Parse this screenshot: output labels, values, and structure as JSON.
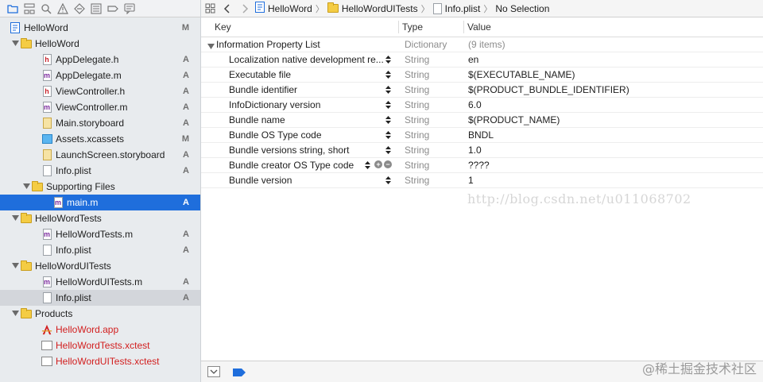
{
  "navigator": {
    "toolbar_icons": [
      "folder-icon",
      "hierarchy-icon",
      "search-icon",
      "warning-icon",
      "diamond-icon",
      "list-icon",
      "tag-icon",
      "speech-bubble-icon"
    ],
    "items": [
      {
        "label": "HelloWord",
        "badge": "M",
        "depth": 0,
        "icon": "project-icon",
        "disclosure": "open"
      },
      {
        "label": "HelloWord",
        "badge": "",
        "depth": 1,
        "icon": "folder-icon",
        "disclosure": "open"
      },
      {
        "label": "AppDelegate.h",
        "badge": "A",
        "depth": 2,
        "icon": "header-file-icon"
      },
      {
        "label": "AppDelegate.m",
        "badge": "A",
        "depth": 2,
        "icon": "objc-file-icon"
      },
      {
        "label": "ViewController.h",
        "badge": "A",
        "depth": 2,
        "icon": "header-file-icon"
      },
      {
        "label": "ViewController.m",
        "badge": "A",
        "depth": 2,
        "icon": "objc-file-icon"
      },
      {
        "label": "Main.storyboard",
        "badge": "A",
        "depth": 2,
        "icon": "storyboard-icon"
      },
      {
        "label": "Assets.xcassets",
        "badge": "M",
        "depth": 2,
        "icon": "assets-icon"
      },
      {
        "label": "LaunchScreen.storyboard",
        "badge": "A",
        "depth": 2,
        "icon": "storyboard-icon"
      },
      {
        "label": "Info.plist",
        "badge": "A",
        "depth": 2,
        "icon": "plist-file-icon"
      },
      {
        "label": "Supporting Files",
        "badge": "",
        "depth": 2,
        "icon": "folder-icon",
        "disclosure": "open"
      },
      {
        "label": "main.m",
        "badge": "A",
        "depth": 3,
        "icon": "objc-file-icon",
        "selected": true
      },
      {
        "label": "HelloWordTests",
        "badge": "",
        "depth": 1,
        "icon": "folder-icon",
        "disclosure": "open"
      },
      {
        "label": "HelloWordTests.m",
        "badge": "A",
        "depth": 2,
        "icon": "objc-file-icon"
      },
      {
        "label": "Info.plist",
        "badge": "A",
        "depth": 2,
        "icon": "plist-file-icon"
      },
      {
        "label": "HelloWordUITests",
        "badge": "",
        "depth": 1,
        "icon": "folder-icon",
        "disclosure": "open"
      },
      {
        "label": "HelloWordUITests.m",
        "badge": "A",
        "depth": 2,
        "icon": "objc-file-icon"
      },
      {
        "label": "Info.plist",
        "badge": "A",
        "depth": 2,
        "icon": "plist-file-icon",
        "highlighted": true
      },
      {
        "label": "Products",
        "badge": "",
        "depth": 1,
        "icon": "folder-icon",
        "disclosure": "open"
      },
      {
        "label": "HelloWord.app",
        "badge": "",
        "depth": 2,
        "icon": "app-icon",
        "red": true
      },
      {
        "label": "HelloWordTests.xctest",
        "badge": "",
        "depth": 2,
        "icon": "bundle-file-icon",
        "red": true
      },
      {
        "label": "HelloWordUITests.xctest",
        "badge": "",
        "depth": 2,
        "icon": "bundle-file-icon",
        "red": true
      }
    ]
  },
  "jumpbar": {
    "crumbs": [
      {
        "label": "HelloWord",
        "icon": "project-icon"
      },
      {
        "label": "HelloWordUITests",
        "icon": "folder-icon"
      },
      {
        "label": "Info.plist",
        "icon": "plist-file-icon"
      },
      {
        "label": "No Selection",
        "icon": ""
      }
    ]
  },
  "plist": {
    "columns": {
      "key": "Key",
      "type": "Type",
      "value": "Value"
    },
    "rows": [
      {
        "key": "Information Property List",
        "type": "Dictionary",
        "value": "(9 items)",
        "root": true
      },
      {
        "key": "Localization native development re...",
        "type": "String",
        "value": "en"
      },
      {
        "key": "Executable file",
        "type": "String",
        "value": "$(EXECUTABLE_NAME)"
      },
      {
        "key": "Bundle identifier",
        "type": "String",
        "value": "$(PRODUCT_BUNDLE_IDENTIFIER)"
      },
      {
        "key": "InfoDictionary version",
        "type": "String",
        "value": "6.0"
      },
      {
        "key": "Bundle name",
        "type": "String",
        "value": "$(PRODUCT_NAME)"
      },
      {
        "key": "Bundle OS Type code",
        "type": "String",
        "value": "BNDL"
      },
      {
        "key": "Bundle versions string, short",
        "type": "String",
        "value": "1.0"
      },
      {
        "key": "Bundle creator OS Type code",
        "type": "String",
        "value": "????",
        "hover": true
      },
      {
        "key": "Bundle version",
        "type": "String",
        "value": "1"
      }
    ]
  },
  "watermark": "http://blog.csdn.net/u011068702",
  "corner_watermark": "@稀土掘金技术社区",
  "colors": {
    "selection": "#1f6edc",
    "badge": "#6f6f6f",
    "missing_product": "#d21e1e",
    "folder": "#f4cc44"
  }
}
